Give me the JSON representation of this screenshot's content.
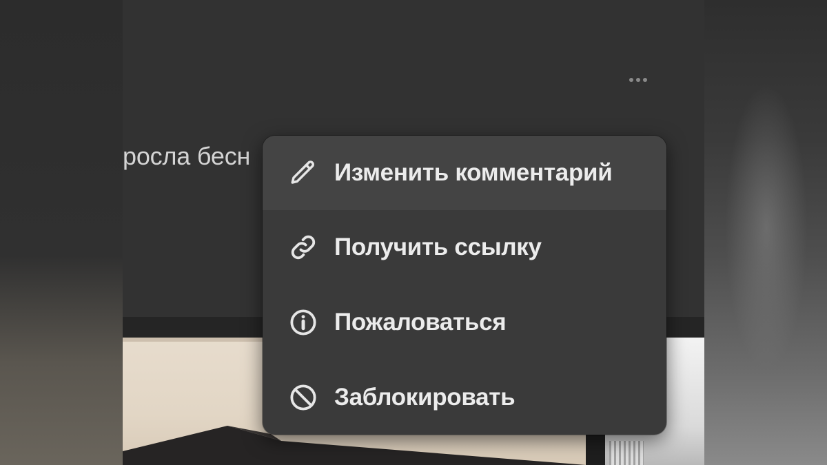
{
  "post": {
    "text_fragment": "росла бесн",
    "more_button_icon": "more-horizontal-icon"
  },
  "context_menu": {
    "items": [
      {
        "label": "Изменить комментарий",
        "icon": "pencil-icon",
        "highlighted": true
      },
      {
        "label": "Получить ссылку",
        "icon": "link-icon",
        "highlighted": false
      },
      {
        "label": "Пожаловаться",
        "icon": "info-icon",
        "highlighted": false
      },
      {
        "label": "Заблокировать",
        "icon": "block-icon",
        "highlighted": false
      }
    ]
  },
  "colors": {
    "menu_background": "#3a3a3a",
    "menu_hover": "#444444",
    "menu_text": "#ececec",
    "post_background": "#323232"
  }
}
